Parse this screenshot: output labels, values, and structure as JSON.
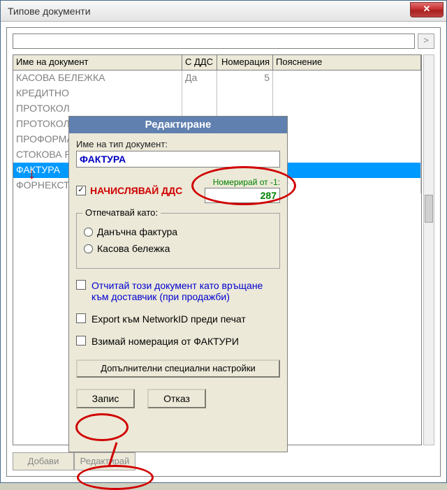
{
  "window": {
    "title": "Типове документи"
  },
  "search": {
    "value": "",
    "go": ">"
  },
  "columns": {
    "name": "Име на документ",
    "dds": "С ДДС",
    "num": "Номерация",
    "desc": "Пояснение"
  },
  "rows": [
    {
      "name": "КАСОВА БЕЛЕЖКА",
      "dds": "Да",
      "num": "5",
      "desc": ""
    },
    {
      "name": "КРЕДИТНО",
      "dds": "",
      "num": "",
      "desc": ""
    },
    {
      "name": "ПРОТОКОЛ",
      "dds": "",
      "num": "",
      "desc": ""
    },
    {
      "name": "ПРОТОКОЛ",
      "dds": "",
      "num": "",
      "desc": ""
    },
    {
      "name": "ПРОФОРМА",
      "dds": "",
      "num": "",
      "desc": ""
    },
    {
      "name": "СТОКОВА Р",
      "dds": "",
      "num": "",
      "desc": ""
    },
    {
      "name": "ФАКТУРА",
      "dds": "",
      "num": "",
      "desc": "",
      "selected": true
    },
    {
      "name": "ФОРНЕКСТ",
      "dds": "",
      "num": "",
      "desc": ""
    }
  ],
  "bottom": {
    "add": "Добави",
    "edit": "Редактирай"
  },
  "dialog": {
    "title": "Редактиране",
    "name_label": "Име на тип документ:",
    "name_value": "ФАКТУРА",
    "charge_dds": "НАЧИСЛЯВАЙ ДДС",
    "charge_checked": "✓",
    "number_from_label": "Номерирай от -1:",
    "number_from_value": "287",
    "print_as": "Отпечатвай като:",
    "radio1": "Данъчна фактура",
    "radio2": "Касова бележка",
    "return_supplier": "Отчитай този документ като връщане",
    "return_supplier2": "към доставчик (при продажби)",
    "export_net": "Export към NetworkID преди печат",
    "take_num": "Взимай номерация от ФАКТУРИ",
    "extra": "Допълнителни специални настройки",
    "save": "Запис",
    "cancel": "Отказ"
  }
}
